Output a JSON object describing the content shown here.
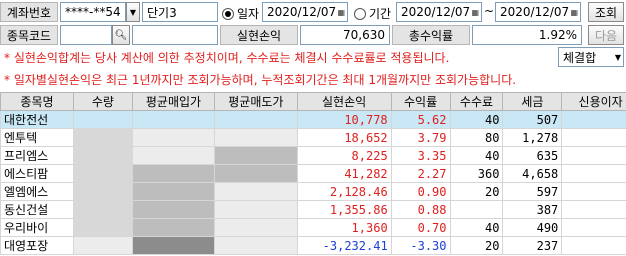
{
  "account": {
    "label": "계좌번호",
    "number": "****-**54",
    "type": "단기3"
  },
  "period": {
    "date_option": "일자",
    "range_option": "기간",
    "date_single": "2020/12/07",
    "date_from": "2020/12/07",
    "date_to": "2020/12/07",
    "separator": "~",
    "search_button": "조회",
    "next_button": "다음"
  },
  "stock_code": {
    "label": "종목코드",
    "value": ""
  },
  "summary": {
    "profit_label": "실현손익",
    "profit_value": "70,630",
    "rate_label": "총수익률",
    "rate_value": "1.92%",
    "basis_select": "체결합"
  },
  "notices": [
    "* 실현손익합계는 당사 계산에 의한 추정치이며, 수수료는 체결시 수수료률로 적용됩니다.",
    "* 일자별실현손익은 최근 1년까지만 조회가능하며, 누적조회기간은 최대 1개월까지만 조회가능합니다."
  ],
  "table": {
    "headers": [
      "종목명",
      "수량",
      "평균매입가",
      "평균매도가",
      "실현손익",
      "수익률",
      "수수료",
      "세금",
      "신용이자"
    ],
    "rows": [
      {
        "name": "대한전선",
        "profit": "10,778",
        "rate": "5.62",
        "fee": "40",
        "tax": "507",
        "sign": "pos",
        "selected": true
      },
      {
        "name": "엔투텍",
        "profit": "18,652",
        "rate": "3.79",
        "fee": "80",
        "tax": "1,278",
        "sign": "pos",
        "selected": false
      },
      {
        "name": "프리엠스",
        "profit": "8,225",
        "rate": "3.35",
        "fee": "40",
        "tax": "635",
        "sign": "pos",
        "selected": false
      },
      {
        "name": "에스티팜",
        "profit": "41,282",
        "rate": "2.27",
        "fee": "360",
        "tax": "4,658",
        "sign": "pos",
        "selected": false
      },
      {
        "name": "엘엠에스",
        "profit": "2,128.46",
        "rate": "0.90",
        "fee": "20",
        "tax": "597",
        "sign": "pos",
        "selected": false
      },
      {
        "name": "동신건설",
        "profit": "1,355.86",
        "rate": "0.88",
        "fee": "",
        "tax": "387",
        "sign": "pos",
        "selected": false
      },
      {
        "name": "우리바이",
        "profit": "1,360",
        "rate": "0.70",
        "fee": "40",
        "tax": "490",
        "sign": "pos",
        "selected": false
      },
      {
        "name": "대영포장",
        "profit": "-3,232.41",
        "rate": "-3.30",
        "fee": "20",
        "tax": "237",
        "sign": "neg",
        "selected": false
      }
    ]
  },
  "icons": {
    "account_dropdown": "chevron-down-icon",
    "stock_search": "search-icon",
    "date_picker": "calendar-icon"
  }
}
